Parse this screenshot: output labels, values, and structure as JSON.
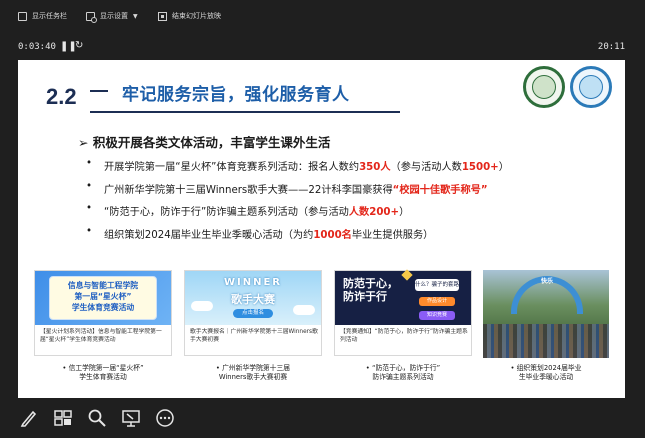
{
  "toolbar": {
    "show_taskbar": "显示任务栏",
    "display_settings": "显示设置",
    "display_settings_arrow": "▼",
    "end_slideshow": "结束幻灯片放映"
  },
  "timer": {
    "elapsed": "0:03:40",
    "pause_icon": "❚❚",
    "restart_icon": "↻",
    "clock": "20:11"
  },
  "slide": {
    "section_number": "2.2",
    "section_title": "牢记服务宗旨，强化服务育人",
    "subheading": "➢ 积极开展各类文体活动，丰富学生课外生活",
    "bullets": [
      {
        "pre": "开展学院第一届“星火杯”体育竞赛系列活动：报名人数约",
        "hl": "350人",
        "post": "（参与活动人数",
        "hl2": "1500+",
        "post2": "）"
      },
      {
        "pre": "广州新华学院第十三届Winners歌手大赛——22计科李国豪获得",
        "hl": "“校园十佳歌手称号”",
        "post": "",
        "hl2": "",
        "post2": ""
      },
      {
        "pre": "“防范于心，防诈于行”防诈骗主题系列活动（参与活动",
        "hl": "人数200+",
        "post": "）",
        "hl2": "",
        "post2": ""
      },
      {
        "pre": "组织策划2024届毕业生毕业季暖心活动（为约",
        "hl": "1000名",
        "post": "毕业生提供服务）",
        "hl2": "",
        "post2": ""
      }
    ],
    "cards": [
      {
        "thumb_text": "信息与智能工程学院\n第一届“星火杯”\n学生体育竞赛活动",
        "desc": "【星火计划系列活动】信息与智能工程学院第一届“星火杯”学生体育竞赛活动",
        "caption": "• 信工学院第一届“星火杯”\n学生体育赛活动"
      },
      {
        "thumb_word": "WINNER",
        "thumb_sub": "歌手大赛",
        "thumb_btn": "点击报名",
        "desc": "歌手大赛报名｜广州新华学院第十三届Winners歌手大赛初赛",
        "caption": "• 广州新华学院第十三届\nWinners歌手大赛初赛"
      },
      {
        "thumb_text": "防范于心，\n防诈于行",
        "thumb_tag1": "什么？骗子的套路",
        "thumb_tag2": "作品设计",
        "thumb_tag3": "知识竞赛",
        "desc": "【竞赛通知】“防范于心，防诈于行”防诈骗主题系列活动",
        "caption": "• “防范于心，防诈于行”\n防诈骗主题系列活动"
      },
      {
        "photo_text": "快乐",
        "caption": "• 组织策划2024届毕业\n生毕业季暖心活动"
      }
    ]
  },
  "bottom_toolbar": {
    "pen_icon": "pen-icon",
    "slides_icon": "all-slides-icon",
    "zoom_icon": "magnifier-icon",
    "screen_icon": "screen-pointer-icon",
    "more_icon": "more-options-icon"
  }
}
